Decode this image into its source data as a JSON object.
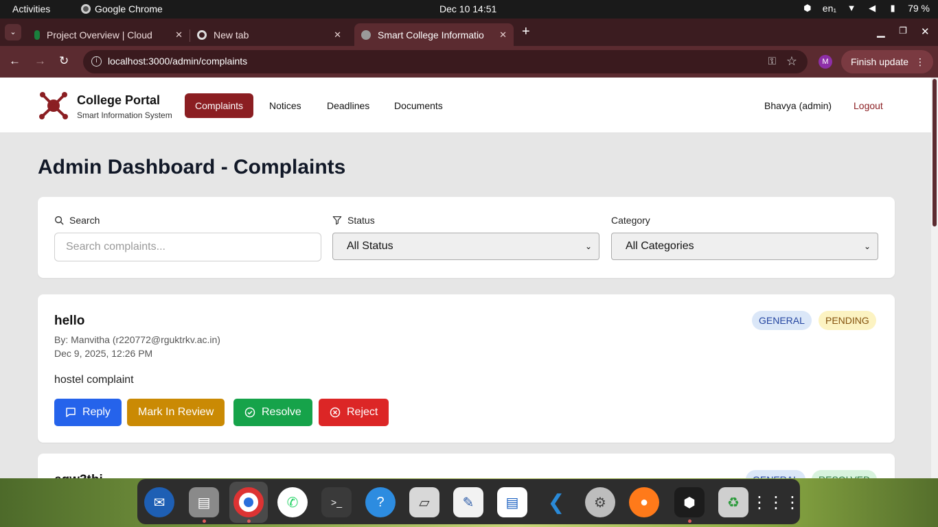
{
  "os": {
    "activities": "Activities",
    "app": "Google Chrome",
    "clock": "Dec 10  14:51",
    "lang": "en₁",
    "battery": "79 %"
  },
  "browser": {
    "tabs": [
      {
        "title": "Project Overview | Cloud"
      },
      {
        "title": "New tab"
      },
      {
        "title": "Smart College Informatio"
      }
    ],
    "url": "localhost:3000/admin/complaints",
    "profile_initial": "M",
    "finish_update": "Finish update"
  },
  "nav": {
    "brand_title": "College Portal",
    "brand_subtitle": "Smart Information System",
    "links": [
      "Complaints",
      "Notices",
      "Deadlines",
      "Documents"
    ],
    "user": "Bhavya (admin)",
    "logout": "Logout"
  },
  "page": {
    "title": "Admin Dashboard - Complaints"
  },
  "filters": {
    "search_label": "Search",
    "search_placeholder": "Search complaints...",
    "status_label": "Status",
    "status_value": "All Status",
    "category_label": "Category",
    "category_value": "All Categories"
  },
  "complaints": [
    {
      "title": "hello",
      "by": "By: Manvitha (r220772@rguktrkv.ac.in)",
      "date": "Dec 9, 2025, 12:26 PM",
      "body": "hostel complaint",
      "category": "GENERAL",
      "status": "PENDING",
      "actions": [
        "Reply",
        "Mark In Review",
        "Resolve",
        "Reject"
      ]
    },
    {
      "title": "eqw3tbi",
      "category": "GENERAL",
      "status": "RESOLVED"
    }
  ],
  "colors": {
    "brand": "#8b1e22",
    "reply": "#2563eb",
    "review": "#ca8a04",
    "resolve": "#16a34a",
    "reject": "#dc2626"
  }
}
